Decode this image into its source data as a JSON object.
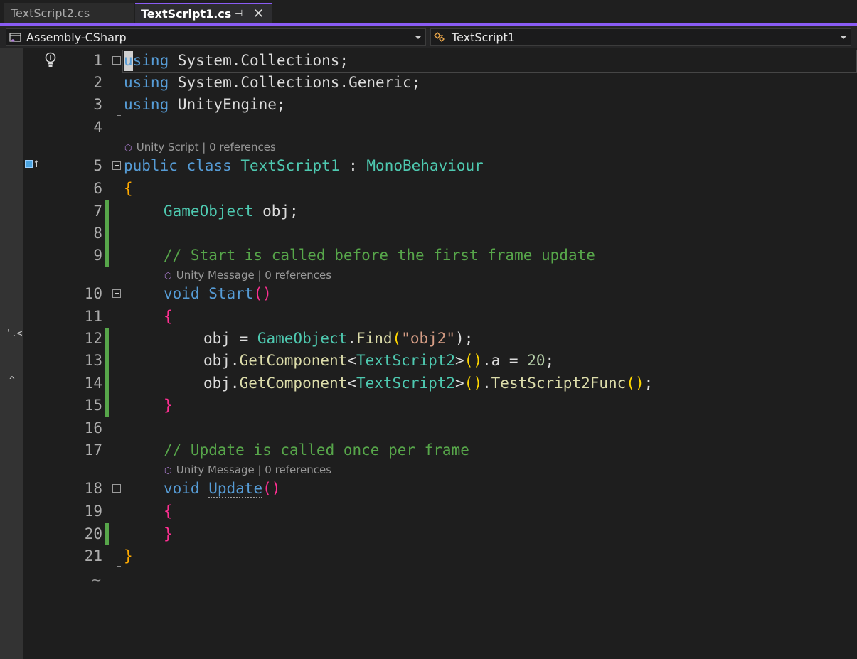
{
  "tabs": [
    {
      "label": "TextScript2.cs",
      "active": false
    },
    {
      "label": "TextScript1.cs",
      "active": true
    }
  ],
  "tab_icons": {
    "pin": "pin-icon",
    "close": "close-icon"
  },
  "nav": {
    "project": "Assembly-CSharp",
    "member": "TextScript1"
  },
  "margin_fragments": [
    "'.<",
    "^"
  ],
  "codelens": {
    "class": {
      "source": "Unity Script",
      "refs": "0 references"
    },
    "start": {
      "source": "Unity Message",
      "refs": "0 references"
    },
    "update": {
      "source": "Unity Message",
      "refs": "0 references"
    }
  },
  "line_numbers": [
    "1",
    "2",
    "3",
    "4",
    "5",
    "6",
    "7",
    "8",
    "9",
    "10",
    "11",
    "12",
    "13",
    "14",
    "15",
    "16",
    "17",
    "18",
    "19",
    "20",
    "21"
  ],
  "code": {
    "l1": [
      "using",
      " System.Collections;"
    ],
    "l2": [
      "using",
      " System.Collections.Generic;"
    ],
    "l3": [
      "using",
      " UnityEngine;"
    ],
    "l5": [
      "public",
      " ",
      "class",
      " ",
      "TextScript1",
      " : ",
      "MonoBehaviour"
    ],
    "l6": [
      "{"
    ],
    "l7": [
      "GameObject",
      " obj;"
    ],
    "l9": [
      "// Start is called before the first frame update"
    ],
    "l10": [
      "void",
      " ",
      "Start",
      "(",
      ")"
    ],
    "l11": [
      "{"
    ],
    "l12": [
      "obj = ",
      "GameObject",
      ".",
      "Find",
      "(",
      "\"obj2\"",
      ");"
    ],
    "l13": [
      "obj.",
      "GetComponent",
      "<",
      "TextScript2",
      ">",
      "(",
      ")",
      ".a = ",
      "20",
      ";"
    ],
    "l14": [
      "obj.",
      "GetComponent",
      "<",
      "TextScript2",
      ">",
      "(",
      ")",
      ".",
      "TestScript2Func",
      "(",
      ")",
      ";"
    ],
    "l15": [
      "}"
    ],
    "l17": [
      "// Update is called once per frame"
    ],
    "l18": [
      "void",
      " ",
      "Update",
      "(",
      ")"
    ],
    "l19": [
      "{"
    ],
    "l20": [
      "}"
    ],
    "l21": [
      "}"
    ]
  },
  "end_marker": "~",
  "colors": {
    "accent": "#8a5cf5",
    "keyword": "#569cd6",
    "type": "#4ec9b0",
    "comment": "#57a64a",
    "string": "#d69d85",
    "method": "#dcdcaa",
    "number": "#b5cea8",
    "change_bar": "#57a64a"
  }
}
